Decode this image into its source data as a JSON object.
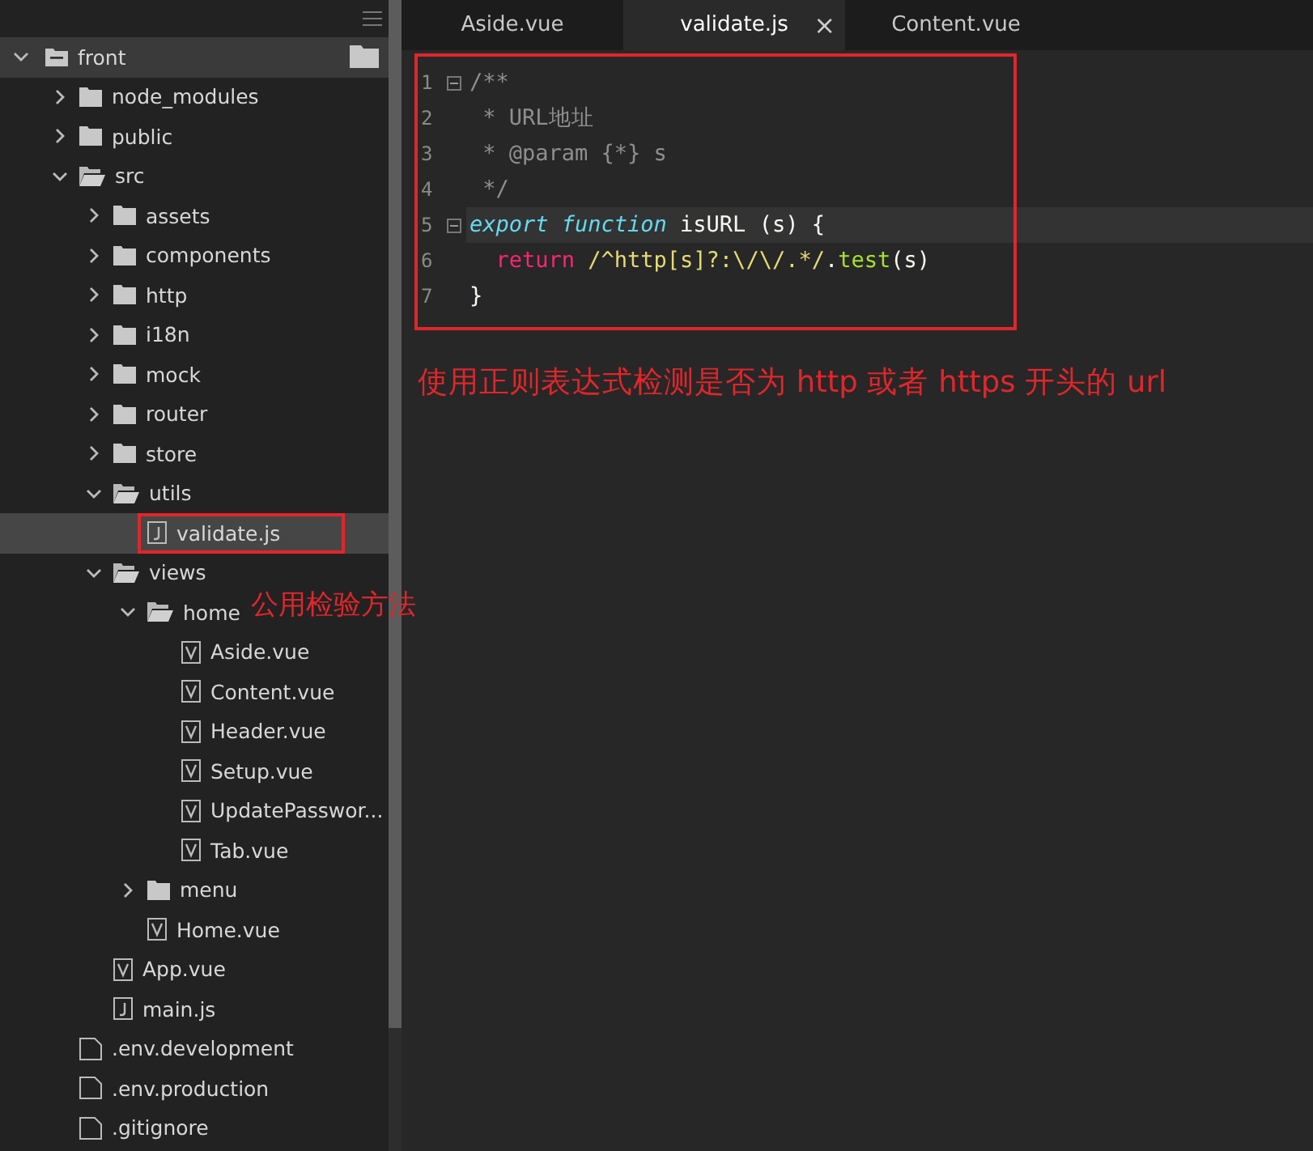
{
  "tree": [
    {
      "name": "front",
      "kind": "folder",
      "expanded": true,
      "selected": false,
      "children": [
        {
          "name": "node_modules",
          "kind": "folder",
          "expanded": false,
          "selected": false
        },
        {
          "name": "public",
          "kind": "folder",
          "expanded": false,
          "selected": false
        },
        {
          "name": "src",
          "kind": "folder",
          "expanded": true,
          "selected": false,
          "children": [
            {
              "name": "assets",
              "kind": "folder",
              "expanded": false,
              "selected": false
            },
            {
              "name": "components",
              "kind": "folder",
              "expanded": false,
              "selected": false
            },
            {
              "name": "http",
              "kind": "folder",
              "expanded": false,
              "selected": false
            },
            {
              "name": "i18n",
              "kind": "folder",
              "expanded": false,
              "selected": false
            },
            {
              "name": "mock",
              "kind": "folder",
              "expanded": false,
              "selected": false
            },
            {
              "name": "router",
              "kind": "folder",
              "expanded": false,
              "selected": false
            },
            {
              "name": "store",
              "kind": "folder",
              "expanded": false,
              "selected": false
            },
            {
              "name": "utils",
              "kind": "folder",
              "expanded": true,
              "selected": false,
              "children": [
                {
                  "name": "validate.js",
                  "kind": "js",
                  "selected": true,
                  "annotated": true
                }
              ]
            },
            {
              "name": "views",
              "kind": "folder",
              "expanded": true,
              "selected": false,
              "children": [
                {
                  "name": "home",
                  "kind": "folder",
                  "expanded": true,
                  "selected": false,
                  "children": [
                    {
                      "name": "Aside.vue",
                      "kind": "vue",
                      "selected": false
                    },
                    {
                      "name": "Content.vue",
                      "kind": "vue",
                      "selected": false
                    },
                    {
                      "name": "Header.vue",
                      "kind": "vue",
                      "selected": false
                    },
                    {
                      "name": "Setup.vue",
                      "kind": "vue",
                      "selected": false
                    },
                    {
                      "name": "UpdatePasswor...",
                      "kind": "vue",
                      "selected": false
                    },
                    {
                      "name": "Tab.vue",
                      "kind": "vue",
                      "selected": false
                    }
                  ]
                },
                {
                  "name": "menu",
                  "kind": "folder",
                  "expanded": false,
                  "selected": false
                },
                {
                  "name": "Home.vue",
                  "kind": "vue",
                  "selected": false
                }
              ]
            },
            {
              "name": "App.vue",
              "kind": "vue",
              "selected": false
            },
            {
              "name": "main.js",
              "kind": "js",
              "selected": false
            }
          ]
        },
        {
          "name": ".env.development",
          "kind": "plain",
          "selected": false
        },
        {
          "name": ".env.production",
          "kind": "plain",
          "selected": false
        },
        {
          "name": ".gitignore",
          "kind": "plain",
          "selected": false
        }
      ]
    }
  ],
  "tabs": [
    {
      "label": "Aside.vue",
      "selected": false
    },
    {
      "label": "validate.js",
      "selected": true,
      "close": "×"
    },
    {
      "label": "Content.vue",
      "selected": false
    }
  ],
  "editor": {
    "annotated": true,
    "lines": [
      {
        "number": "1",
        "fold": true,
        "current": false,
        "tokens": [
          {
            "kind": "comment",
            "text": "/**"
          }
        ]
      },
      {
        "number": "2",
        "fold": false,
        "current": false,
        "tokens": [
          {
            "kind": "comment",
            "text": " * URL地址"
          }
        ]
      },
      {
        "number": "3",
        "fold": false,
        "current": false,
        "tokens": [
          {
            "kind": "comment",
            "text": " * @param {*} s"
          }
        ]
      },
      {
        "number": "4",
        "fold": false,
        "current": false,
        "tokens": [
          {
            "kind": "comment",
            "text": " */"
          }
        ]
      },
      {
        "number": "5",
        "fold": true,
        "current": true,
        "tokens": [
          {
            "kind": "storage",
            "text": "export function"
          },
          {
            "kind": "plain",
            "text": " isURL (s) {"
          }
        ]
      },
      {
        "number": "6",
        "fold": false,
        "current": false,
        "tokens": [
          {
            "kind": "keyword",
            "text": "  return "
          },
          {
            "kind": "regex",
            "text": "/^http[s]?:\\/\\/.*/"
          },
          {
            "kind": "plain",
            "text": "."
          },
          {
            "kind": "call",
            "text": "test"
          },
          {
            "kind": "plain",
            "text": "(s)"
          }
        ]
      },
      {
        "number": "7",
        "fold": false,
        "current": false,
        "tokens": [
          {
            "kind": "plain",
            "text": "}"
          }
        ]
      }
    ]
  },
  "editor_note": "使用正则表达式检测是否为 http 或者 https 开头的 url",
  "tree_note": "公用检验方法"
}
